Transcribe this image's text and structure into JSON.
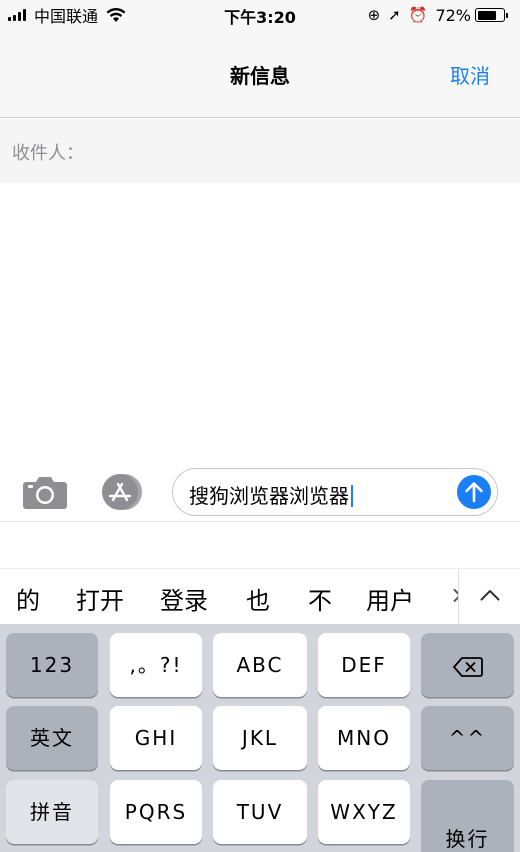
{
  "status_bar": {
    "carrier": "中国联通",
    "time": "下午3:20",
    "battery_percent": "72%",
    "battery_level": 0.72
  },
  "nav": {
    "title": "新信息",
    "cancel_label": "取消"
  },
  "recipient": {
    "label": "收件人："
  },
  "compose": {
    "text": "搜狗浏览器浏览器"
  },
  "candidates": [
    "的",
    "打开",
    "登录",
    "也",
    "不",
    "用户",
    "×"
  ],
  "keyboard": {
    "row1": [
      "123",
      ",。?!",
      "ABC",
      "DEF"
    ],
    "row2": [
      "英文",
      "GHI",
      "JKL",
      "MNO",
      "^^"
    ],
    "row3": [
      "拼音",
      "PQRS",
      "TUV",
      "WXYZ",
      "换行"
    ]
  },
  "colors": {
    "accent": "#1a7ff5",
    "keyboard_bg": "#d2d5db",
    "function_key": "#acb2bc"
  }
}
